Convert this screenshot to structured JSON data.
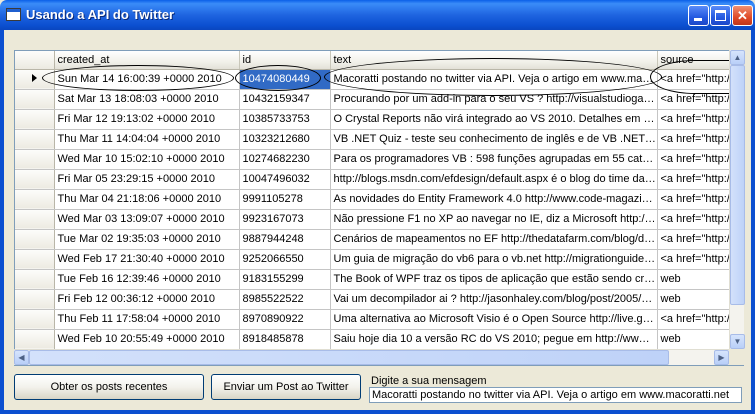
{
  "window": {
    "title": "Usando a API do Twitter"
  },
  "grid": {
    "columns": [
      "created_at",
      "id",
      "text",
      "source"
    ],
    "selected_row": 0,
    "rows": [
      [
        "Sun Mar 14 16:00:39 +0000 2010",
        "10474080449",
        "Macoratti postando no twitter via API. Veja o artigo em www.macoratti.net",
        "<a href=\"http://a..."
      ],
      [
        "Sat Mar 13 18:08:03 +0000 2010",
        "10432159347",
        "Procurando por um add-in para o seu VS ? http://visualstudiogallery.ms...",
        "<a href=\"http://w..."
      ],
      [
        "Fri Mar 12 19:13:02 +0000 2010",
        "10385733753",
        "O Crystal Reports não virá integrado ao VS 2010. Detalhes em http://ti...",
        "<a href=\"http://w..."
      ],
      [
        "Thu Mar 11 14:04:04 +0000 2010",
        "10323212680",
        "VB .NET Quiz - teste seu conhecimento de inglês e de VB .NET http://...",
        "<a href=\"http://w..."
      ],
      [
        "Wed Mar 10 15:02:10 +0000 2010",
        "10274682230",
        "Para os programadores VB : 598 funções agrupadas em 55 categorias =...",
        "<a href=\"http://w..."
      ],
      [
        "Fri Mar 05 23:29:15 +0000 2010",
        "10047496032",
        "http://blogs.msdn.com/efdesign/default.aspx é o blog do time da Micros...",
        "<a href=\"http://w..."
      ],
      [
        "Thu Mar 04 21:18:06 +0000 2010",
        "9991105278",
        "As novidades do Entity Framework 4.0 http://www.code-magazine.com...",
        "<a href=\"http://w..."
      ],
      [
        "Wed Mar 03 13:09:07 +0000 2010",
        "9923167073",
        "Não pressione F1 no XP ao navegar no IE, diz a Microsoft http://bit.ly/...",
        "<a href=\"http://w..."
      ],
      [
        "Tue Mar 02 19:35:03 +0000 2010",
        "9887944248",
        "Cenários de mapeamentos no EF http://thedatafarm.com/blog/data-ac...",
        "<a href=\"http://w..."
      ],
      [
        "Wed Feb 17 21:30:40 +0000 2010",
        "9252066550",
        "Um guia de migração do vb6 para o vb.net http://migrationguide.artins...",
        "<a href=\"http://w..."
      ],
      [
        "Tue Feb 16 12:39:46 +0000 2010",
        "9183155299",
        "The Book of WPF traz os tipos de aplicação que estão sendo criados no...",
        "web"
      ],
      [
        "Fri Feb 12 00:36:12 +0000 2010",
        "8985522522",
        "Vai um decompilador ai ? http://jasonhaley.com/blog/post/2005/09/25/...",
        "web"
      ],
      [
        "Thu Feb 11 17:58:04 +0000 2010",
        "8970890922",
        "Uma alternativa ao Microsoft Visio é o Open Source http://live.gnome.o...",
        "<a href=\"http://w..."
      ],
      [
        "Wed Feb 10 20:55:49 +0000 2010",
        "8918485878",
        "Saiu hoje dia 10 a versão RC  do VS 2010; pegue em http://www.micros...",
        "web"
      ]
    ]
  },
  "buttons": {
    "get_posts": "Obter os posts recentes",
    "send_post": "Enviar um Post ao Twitter"
  },
  "message": {
    "label": "Digite a sua mensagem",
    "value": "Macoratti postando no twitter via API. Veja o artigo em www.macoratti.net"
  },
  "colors": {
    "titlebar": "#0B4FD0",
    "selection": "#316AC5"
  }
}
